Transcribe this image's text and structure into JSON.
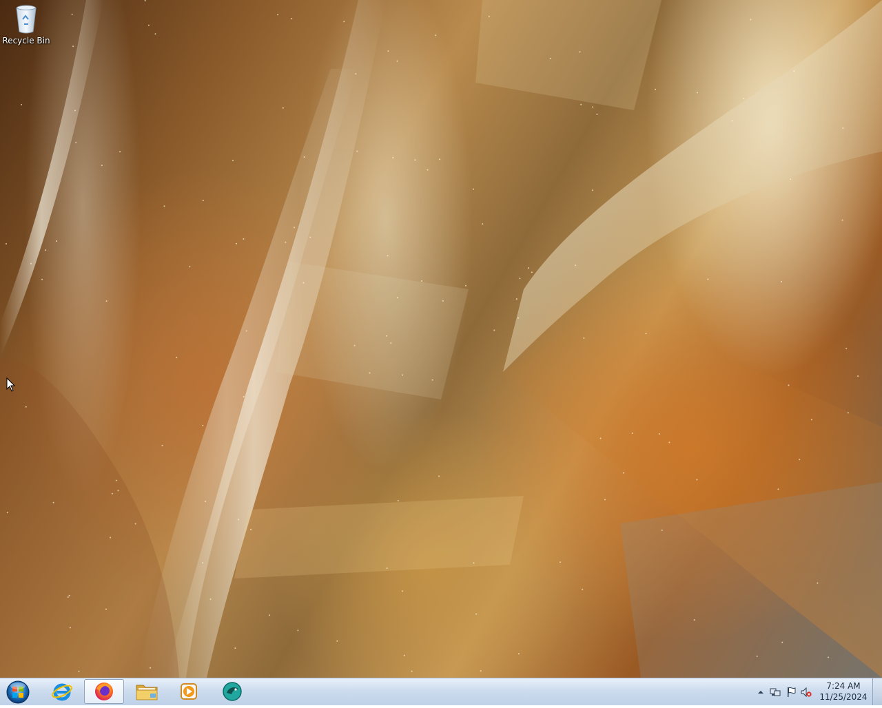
{
  "desktop": {
    "icons": [
      {
        "label": "Recycle Bin",
        "icon": "recycle-bin-icon"
      }
    ]
  },
  "taskbar": {
    "start": {
      "icon": "windows-orb-icon"
    },
    "pinned": [
      {
        "name": "Internet Explorer",
        "icon": "internet-explorer-icon",
        "active": false
      },
      {
        "name": "Firefox",
        "icon": "firefox-icon",
        "active": true
      },
      {
        "name": "Windows Explorer",
        "icon": "folder-icon",
        "active": false
      },
      {
        "name": "Windows Media Player",
        "icon": "media-player-icon",
        "active": false
      },
      {
        "name": "App",
        "icon": "teal-bird-app-icon",
        "active": false
      }
    ],
    "tray": {
      "icons": [
        "show-hidden-icons-icon",
        "network-icon",
        "action-center-flag-icon",
        "volume-muted-icon"
      ],
      "time": "7:24 AM",
      "date": "11/25/2024"
    }
  },
  "colors": {
    "taskbar_top": "#e9f1fa",
    "taskbar_bottom": "#bed1e8",
    "wallpaper_primary": "#b98b4e"
  }
}
